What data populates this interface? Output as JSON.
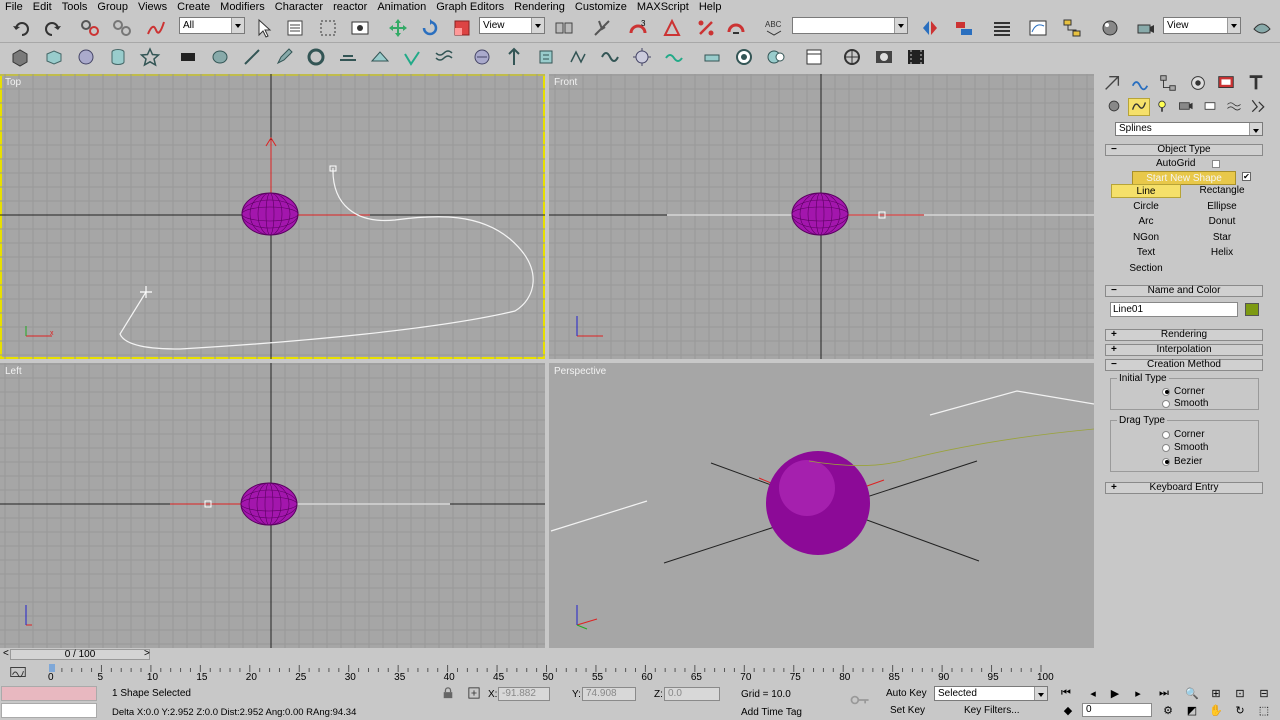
{
  "menu": [
    "File",
    "Edit",
    "Tools",
    "Group",
    "Views",
    "Create",
    "Modifiers",
    "Character",
    "reactor",
    "Animation",
    "Graph Editors",
    "Rendering",
    "Customize",
    "MAXScript",
    "Help"
  ],
  "toolbar": {
    "selection_filter": "All",
    "ref_coord": "View",
    "named_sel": "",
    "render_view": "View"
  },
  "viewports": {
    "top": "Top",
    "front": "Front",
    "left": "Left",
    "perspective": "Perspective"
  },
  "panel": {
    "category": "Splines",
    "object_type": "Object Type",
    "autogrid": "AutoGrid",
    "start_new_shape": "Start New Shape",
    "buttons": [
      "Line",
      "Rectangle",
      "Circle",
      "Ellipse",
      "Arc",
      "Donut",
      "NGon",
      "Star",
      "Text",
      "Helix",
      "Section"
    ],
    "selected_button": "Line",
    "name_and_color": "Name and Color",
    "object_name": "Line01",
    "object_color": "#7d9a12",
    "rendering": "Rendering",
    "interpolation": "Interpolation",
    "creation_method": "Creation Method",
    "initial_type": "Initial Type",
    "initial_options": [
      "Corner",
      "Smooth"
    ],
    "drag_type": "Drag Type",
    "drag_options": [
      "Corner",
      "Smooth",
      "Bezier"
    ],
    "keyboard_entry": "Keyboard Entry"
  },
  "timeline": {
    "frame": "0 / 100",
    "ticks": [
      "0",
      "5",
      "10",
      "15",
      "20",
      "25",
      "30",
      "35",
      "40",
      "45",
      "50",
      "55",
      "60",
      "65",
      "70",
      "75",
      "80",
      "85",
      "90",
      "95",
      "100"
    ]
  },
  "status": {
    "selection": "1 Shape Selected",
    "prompt": "Delta X:0.0  Y:2.952  Z:0.0  Dist:2.952  Ang:0.00  RAng:94.34",
    "x_label": "X:",
    "x_value": "-91.882",
    "y_label": "Y:",
    "y_value": "74.908",
    "z_label": "Z:",
    "z_value": "0.0",
    "grid": "Grid = 10.0",
    "add_time_tag": "Add Time Tag",
    "auto_key": "Auto Key",
    "set_key": "Set Key",
    "key_mode": "Selected",
    "key_filters": "Key Filters...",
    "current_frame": "0"
  },
  "colors": {
    "sphere": "#9b0fa6",
    "active_viewport": "#e8e000",
    "selected_button": "#f5e06a"
  }
}
